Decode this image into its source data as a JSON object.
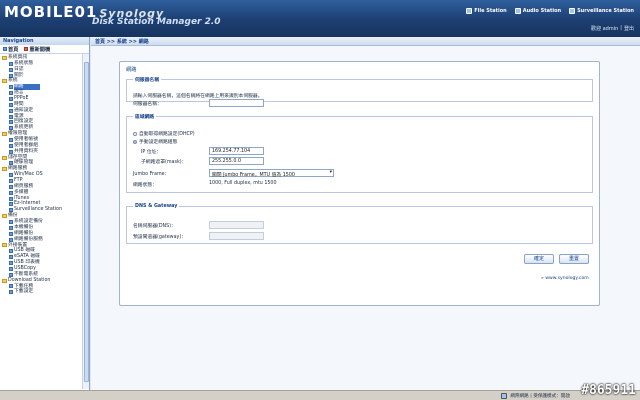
{
  "header": {
    "logo_text": "MOBILE01",
    "brand": "Synology",
    "title": "Disk Station Manager 2.0",
    "nav": [
      {
        "icon": "file-station-icon",
        "label": "File Station"
      },
      {
        "icon": "audio-station-icon",
        "label": "Audio Station"
      },
      {
        "icon": "surveillance-station-icon",
        "label": "Surveillance Station"
      }
    ],
    "welcome": "歡迎 admin",
    "logout": "登出"
  },
  "navigation": {
    "title": "Navigation",
    "home": "首頁",
    "reload": "重新開機",
    "tree": [
      {
        "t": "grp",
        "label": "系統資訊"
      },
      {
        "t": "itm",
        "label": "系統狀態"
      },
      {
        "t": "itm",
        "label": "日誌"
      },
      {
        "t": "itm",
        "label": "關於"
      },
      {
        "t": "grp",
        "label": "系統"
      },
      {
        "t": "itm",
        "label": "網路",
        "selected": true
      },
      {
        "t": "itm",
        "label": "語言"
      },
      {
        "t": "itm",
        "label": "PPPoE"
      },
      {
        "t": "itm",
        "label": "時間"
      },
      {
        "t": "itm",
        "label": "通知設定"
      },
      {
        "t": "itm",
        "label": "電源"
      },
      {
        "t": "itm",
        "label": "回復設定"
      },
      {
        "t": "itm",
        "label": "系統更新"
      },
      {
        "t": "grp",
        "label": "權限管理"
      },
      {
        "t": "itm",
        "label": "使用者帳號"
      },
      {
        "t": "itm",
        "label": "使用者群組"
      },
      {
        "t": "itm",
        "label": "共用資料夾"
      },
      {
        "t": "grp",
        "label": "儲存空間"
      },
      {
        "t": "itm",
        "label": "硬碟管理"
      },
      {
        "t": "grp",
        "label": "網路服務"
      },
      {
        "t": "itm",
        "label": "Win/Mac OS"
      },
      {
        "t": "itm",
        "label": "FTP"
      },
      {
        "t": "itm",
        "label": "網頁服務"
      },
      {
        "t": "itm",
        "label": "多媒體"
      },
      {
        "t": "itm",
        "label": "iTunes"
      },
      {
        "t": "itm",
        "label": "Ez-Internet"
      },
      {
        "t": "itm",
        "label": "Surveillance Station"
      },
      {
        "t": "grp",
        "label": "備份"
      },
      {
        "t": "itm",
        "label": "系統設定備份"
      },
      {
        "t": "itm",
        "label": "本機備份"
      },
      {
        "t": "itm",
        "label": "網路備份"
      },
      {
        "t": "itm",
        "label": "網路備份服務"
      },
      {
        "t": "grp",
        "label": "外接裝置"
      },
      {
        "t": "itm",
        "label": "USB 磁碟"
      },
      {
        "t": "itm",
        "label": "eSATA 磁碟"
      },
      {
        "t": "itm",
        "label": "USB 印表機"
      },
      {
        "t": "itm",
        "label": "USBCopy"
      },
      {
        "t": "itm",
        "label": "不斷電系統"
      },
      {
        "t": "grp",
        "label": "Download Station"
      },
      {
        "t": "itm",
        "label": "下載任務"
      },
      {
        "t": "itm",
        "label": "下載設定"
      }
    ]
  },
  "breadcrumb": "首頁 >> 系統 >> 網路",
  "panel": {
    "title": "網路",
    "server_section": "伺服器名稱",
    "server_hint": "請輸入伺服器名稱，這個名稱將在網路上用來識別本伺服器。",
    "server_label": "伺服器名稱：",
    "server_value": "",
    "lan_section": "區域網路",
    "dhcp_label": "自動取得網路設定(DHCP)",
    "manual_label": "手動設定網路組態",
    "ip_label": "IP 位址：",
    "ip_value": "169.254.77.104",
    "mask_label": "子網路遮罩(mask)：",
    "mask_value": "255.255.0.0",
    "jumbo_label": "Jumbo Frame：",
    "jumbo_value": "關閉 Jumbo Frame，MTU 值為 1500",
    "status_label": "網路狀態：",
    "status_value": "1000, Full duplex, mtu 1500",
    "dns_section": "DNS & Gateway",
    "dns_label": "名稱伺服器(DNS)：",
    "gw_label": "預設閘道器(gateway)：",
    "ok": "確定",
    "reset": "重置"
  },
  "site_link": "www.synology.com",
  "statusbar": {
    "left": "",
    "zone": "網際網路 | 受保護模式：開啟"
  },
  "watermark": "#865911"
}
